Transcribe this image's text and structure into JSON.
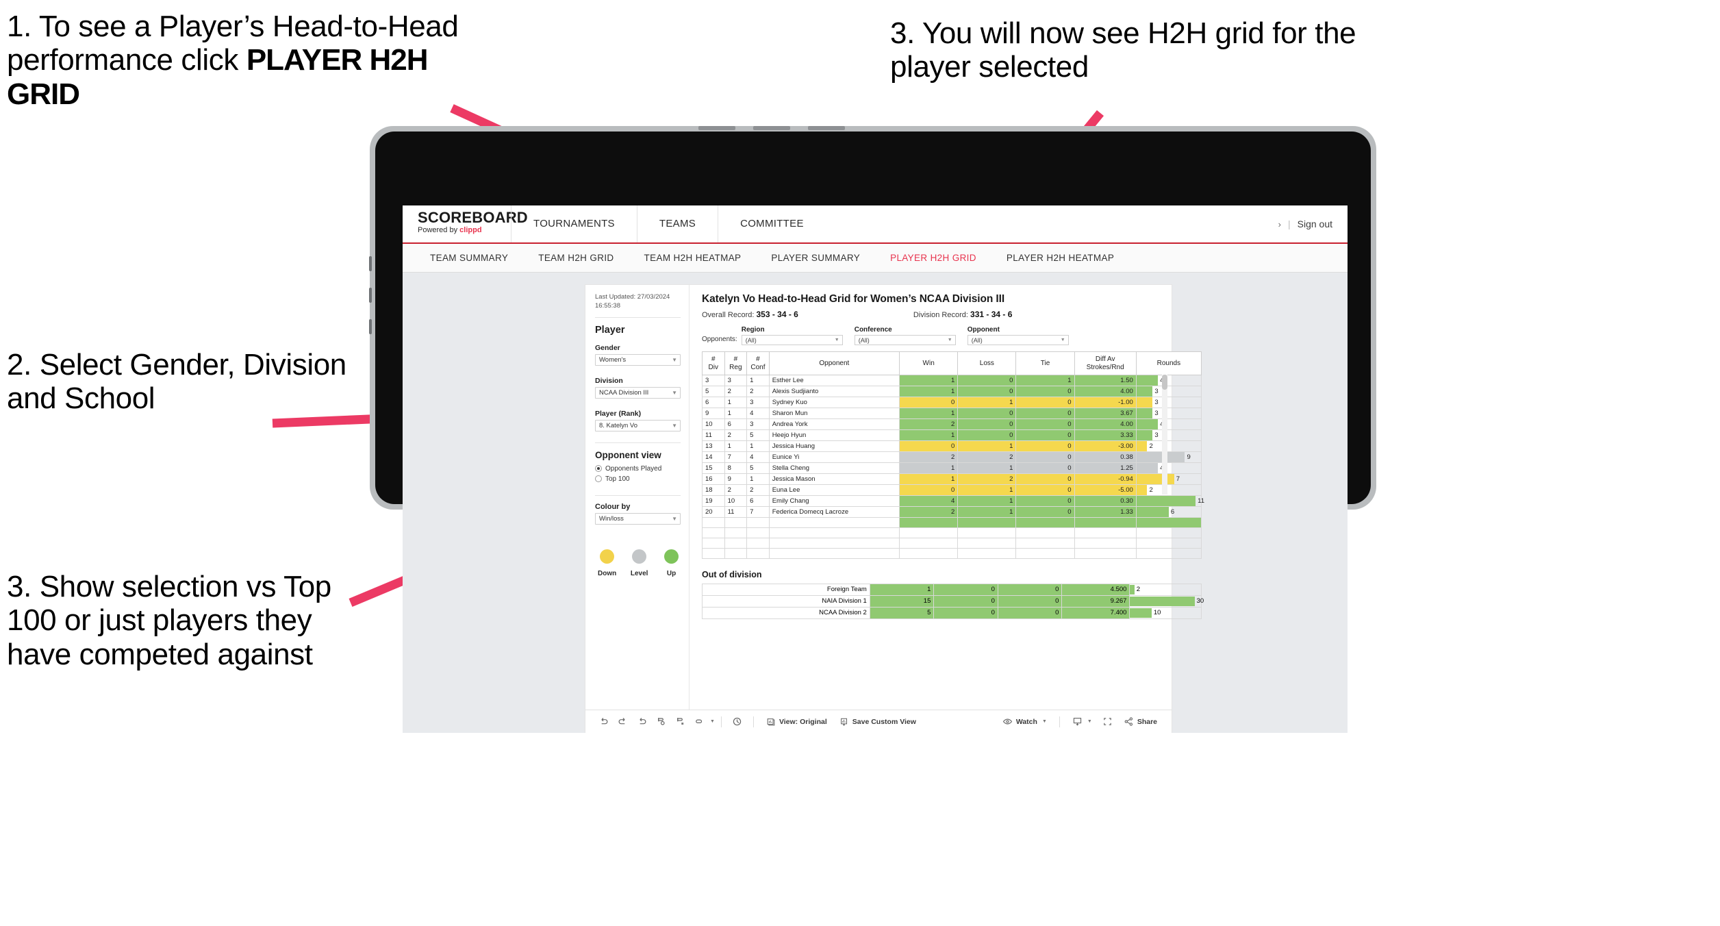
{
  "callouts": [
    {
      "id": 1,
      "text_plain": "1. To see a Player’s Head-to-Head performance click ",
      "text_bold": "PLAYER H2H GRID"
    },
    {
      "id": 2,
      "text": "2. Select Gender, Division and School"
    },
    {
      "id": 3,
      "text": "3. Show selection vs Top 100 or just players they have competed against"
    },
    {
      "id": 4,
      "text": "3. You will now see H2H grid for the player selected"
    }
  ],
  "colors": {
    "accent_pink": "#ec3a64",
    "brand_red": "#e8344e",
    "win_green": "#90c971",
    "loss_yellow": "#f5d84e",
    "level_grey": "#c9ccce",
    "rounds_bar": "#90c971"
  },
  "app": {
    "logo": {
      "word": "SCOREBOARD",
      "powered_prefix": "Powered by ",
      "brand": "clippd"
    },
    "topnav": [
      {
        "label": "TOURNAMENTS"
      },
      {
        "label": "TEAMS"
      },
      {
        "label": "COMMITTEE"
      }
    ],
    "topnav_right": {
      "chevron": "›",
      "separator": "|",
      "signout": "Sign out"
    },
    "subnav": [
      {
        "label": "TEAM SUMMARY",
        "active": false
      },
      {
        "label": "TEAM H2H GRID",
        "active": false
      },
      {
        "label": "TEAM H2H HEATMAP",
        "active": false
      },
      {
        "label": "PLAYER SUMMARY",
        "active": false
      },
      {
        "label": "PLAYER H2H GRID",
        "active": true
      },
      {
        "label": "PLAYER H2H HEATMAP",
        "active": false
      }
    ]
  },
  "rail": {
    "last_updated": "Last Updated: 27/03/2024 16:55:38",
    "player_heading": "Player",
    "fields": [
      {
        "label": "Gender",
        "value": "Women's"
      },
      {
        "label": "Division",
        "value": "NCAA Division III"
      },
      {
        "label": "Player (Rank)",
        "value": "8. Katelyn Vo"
      }
    ],
    "opponent_view": {
      "heading": "Opponent view",
      "options": [
        {
          "label": "Opponents Played",
          "selected": true
        },
        {
          "label": "Top 100",
          "selected": false
        }
      ]
    },
    "colour_by": {
      "label": "Colour by",
      "value": "Win/loss"
    },
    "legend": [
      {
        "caption": "Down",
        "color": "#f2d24b"
      },
      {
        "caption": "Level",
        "color": "#c3c6c8"
      },
      {
        "caption": "Up",
        "color": "#7ec35a"
      }
    ]
  },
  "viz": {
    "title": "Katelyn Vo Head-to-Head Grid for Women’s NCAA Division III",
    "overall_record_label": "Overall Record:",
    "overall_record": "353 -  34 - 6",
    "division_record_label": "Division Record:",
    "division_record": "331 -  34 - 6",
    "opponents_label": "Opponents:",
    "filters": [
      {
        "label": "Region",
        "value": "(All)"
      },
      {
        "label": "Conference",
        "value": "(All)"
      },
      {
        "label": "Opponent",
        "value": "(All)"
      }
    ],
    "table_headers": [
      "#\nDiv",
      "#\nReg",
      "#\nConf",
      "Opponent",
      "Win",
      "Loss",
      "Tie",
      "Diff Av\nStrokes/Rnd",
      "Rounds"
    ],
    "rows": [
      {
        "div": "3",
        "reg": "3",
        "conf": "1",
        "opponent": "Esther Lee",
        "win": "1",
        "loss": "0",
        "tie": "1",
        "diff": "1.50",
        "rounds": "4",
        "state": "up"
      },
      {
        "div": "5",
        "reg": "2",
        "conf": "2",
        "opponent": "Alexis Sudjianto",
        "win": "1",
        "loss": "0",
        "tie": "0",
        "diff": "4.00",
        "rounds": "3",
        "state": "up"
      },
      {
        "div": "6",
        "reg": "1",
        "conf": "3",
        "opponent": "Sydney Kuo",
        "win": "0",
        "loss": "1",
        "tie": "0",
        "diff": "-1.00",
        "rounds": "3",
        "state": "down"
      },
      {
        "div": "9",
        "reg": "1",
        "conf": "4",
        "opponent": "Sharon Mun",
        "win": "1",
        "loss": "0",
        "tie": "0",
        "diff": "3.67",
        "rounds": "3",
        "state": "up"
      },
      {
        "div": "10",
        "reg": "6",
        "conf": "3",
        "opponent": "Andrea York",
        "win": "2",
        "loss": "0",
        "tie": "0",
        "diff": "4.00",
        "rounds": "4",
        "state": "up"
      },
      {
        "div": "11",
        "reg": "2",
        "conf": "5",
        "opponent": "Heejo Hyun",
        "win": "1",
        "loss": "0",
        "tie": "0",
        "diff": "3.33",
        "rounds": "3",
        "state": "up"
      },
      {
        "div": "13",
        "reg": "1",
        "conf": "1",
        "opponent": "Jessica Huang",
        "win": "0",
        "loss": "1",
        "tie": "0",
        "diff": "-3.00",
        "rounds": "2",
        "state": "down"
      },
      {
        "div": "14",
        "reg": "7",
        "conf": "4",
        "opponent": "Eunice Yi",
        "win": "2",
        "loss": "2",
        "tie": "0",
        "diff": "0.38",
        "rounds": "9",
        "state": "level"
      },
      {
        "div": "15",
        "reg": "8",
        "conf": "5",
        "opponent": "Stella Cheng",
        "win": "1",
        "loss": "1",
        "tie": "0",
        "diff": "1.25",
        "rounds": "4",
        "state": "level"
      },
      {
        "div": "16",
        "reg": "9",
        "conf": "1",
        "opponent": "Jessica Mason",
        "win": "1",
        "loss": "2",
        "tie": "0",
        "diff": "-0.94",
        "rounds": "7",
        "state": "down"
      },
      {
        "div": "18",
        "reg": "2",
        "conf": "2",
        "opponent": "Euna Lee",
        "win": "0",
        "loss": "1",
        "tie": "0",
        "diff": "-5.00",
        "rounds": "2",
        "state": "down"
      },
      {
        "div": "19",
        "reg": "10",
        "conf": "6",
        "opponent": "Emily Chang",
        "win": "4",
        "loss": "1",
        "tie": "0",
        "diff": "0.30",
        "rounds": "11",
        "state": "up"
      },
      {
        "div": "20",
        "reg": "11",
        "conf": "7",
        "opponent": "Federica Domecq Lacroze",
        "win": "2",
        "loss": "1",
        "tie": "0",
        "diff": "1.33",
        "rounds": "6",
        "state": "up"
      }
    ],
    "rounds_max": 12,
    "out_of_division": {
      "title": "Out of division",
      "rows": [
        {
          "name": "Foreign Team",
          "win": "1",
          "loss": "0",
          "tie": "0",
          "diff": "4.500",
          "rounds": "2",
          "state": "up"
        },
        {
          "name": "NAIA Division 1",
          "win": "15",
          "loss": "0",
          "tie": "0",
          "diff": "9.267",
          "rounds": "30",
          "state": "up"
        },
        {
          "name": "NCAA Division 2",
          "win": "5",
          "loss": "0",
          "tie": "0",
          "diff": "7.400",
          "rounds": "10",
          "state": "up"
        }
      ],
      "rounds_max": 33
    }
  },
  "toolbar": {
    "icons": [
      "undo-icon",
      "redo-icon",
      "revert-icon",
      "refresh-icon",
      "pause-icon",
      "zoom-icon"
    ],
    "view_label": "View: Original",
    "save_label": "Save Custom View",
    "watch_label": "Watch",
    "share_label": "Share"
  }
}
